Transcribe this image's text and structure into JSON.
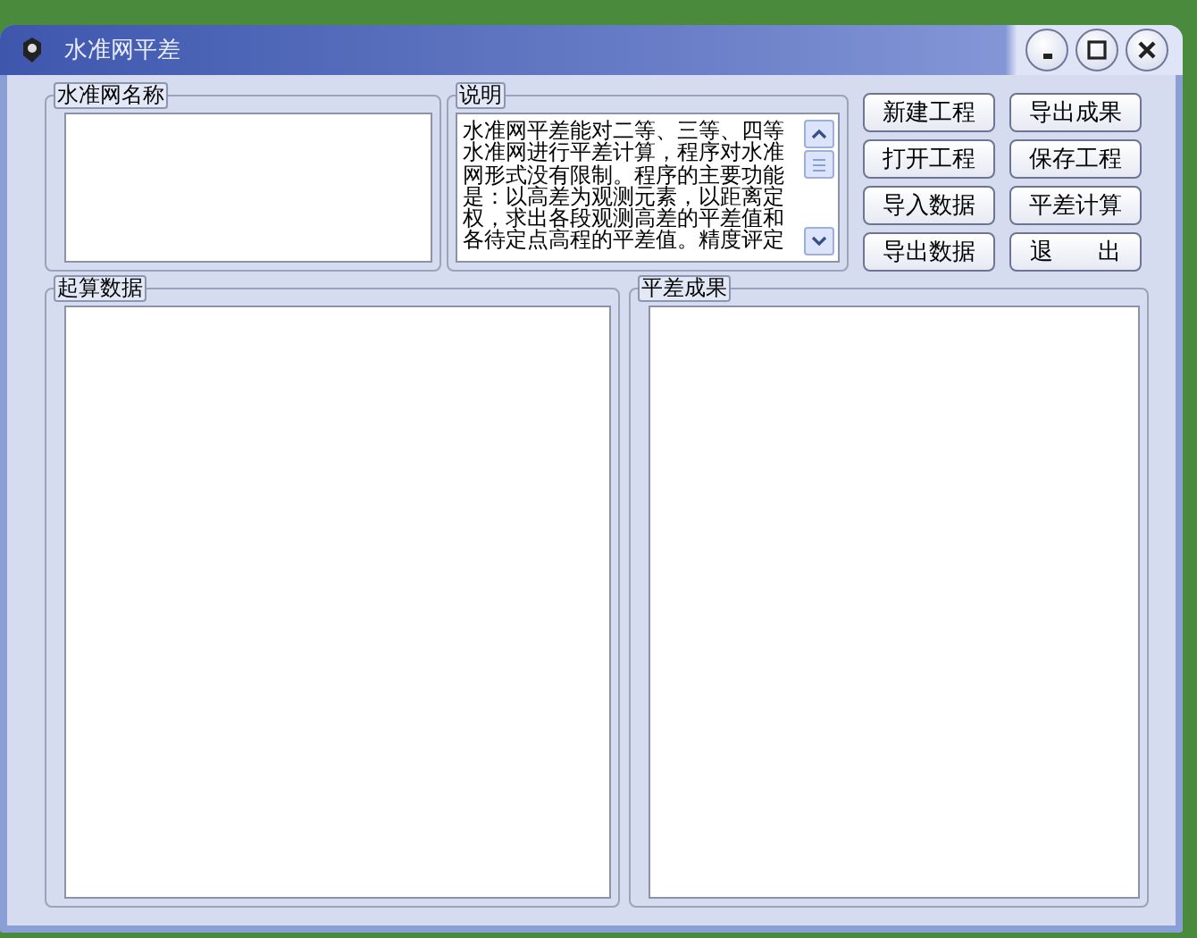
{
  "window": {
    "title": "水准网平差"
  },
  "name_group": {
    "label": "水准网名称"
  },
  "description": {
    "label": "说明",
    "text": "水准网平差能对二等、三等、四等水准网进行平差计算，程序对水准网形式没有限制。程序的主要功能是：以高差为观测元素，以距离定权，求出各段观测高差的平差值和各待定点高程的平差值。精度评定"
  },
  "buttons": [
    {
      "label": "新建工程"
    },
    {
      "label": "导出成果"
    },
    {
      "label": "打开工程"
    },
    {
      "label": "保存工程"
    },
    {
      "label": "导入数据"
    },
    {
      "label": "平差计算"
    },
    {
      "label": "导出数据"
    },
    {
      "label": "退      出"
    }
  ],
  "initial_data": {
    "label": "起算数据"
  },
  "results": {
    "label": "平差成果"
  }
}
